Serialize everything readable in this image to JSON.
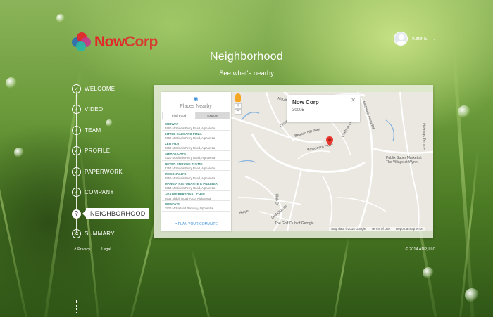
{
  "brand": {
    "name_a": "Now",
    "name_b": "Corp",
    "colors": {
      "red": "#e4262b",
      "blue": "#2e6db4",
      "teal": "#2bb6a3",
      "magenta": "#c4388c"
    }
  },
  "user": {
    "name": "Kate S.",
    "menu_icon": "chevron-down-icon"
  },
  "header": {
    "title": "Neighborhood",
    "subtitle": "See what's nearby"
  },
  "steps": [
    {
      "label": "WELCOME",
      "state": "done"
    },
    {
      "label": "VIDEO",
      "state": "done"
    },
    {
      "label": "TEAM",
      "state": "done"
    },
    {
      "label": "PROFILE",
      "state": "done"
    },
    {
      "label": "PAPERWORK",
      "state": "done"
    },
    {
      "label": "COMPANY",
      "state": "done"
    },
    {
      "label": "NEIGHBORHOOD",
      "state": "current"
    },
    {
      "label": "SUMMARY",
      "state": "upcoming"
    }
  ],
  "footer": {
    "privacy": "Privacy",
    "legal": "Legal",
    "copyright": "© 2014 ADP, LLC."
  },
  "places": {
    "title": "Places Nearby",
    "tabs": [
      "Find Food",
      "Explore"
    ],
    "items": [
      {
        "name": "SUBWAY",
        "address": "5960 McGinnis Ferry Road, Alpharetta"
      },
      {
        "name": "LITTLE CAESARS PIZZA",
        "address": "5960 McGinnis Ferry Road, Alpharetta"
      },
      {
        "name": "ZEN FUJI",
        "address": "5960 McGinnis Ferry Road, Alpharetta"
      },
      {
        "name": "SHIRAZ CAFE",
        "address": "5220 McGinnis Ferry Road, Alpharetta"
      },
      {
        "name": "NEVER ENOUGH THYME",
        "address": "5354 McGinnis Ferry Road, Alpharetta"
      },
      {
        "name": "MCDONALD'S",
        "address": "5950 McGinnis Ferry Road, Alpharetta"
      },
      {
        "name": "MANGIA RISTORANTE & PIZZERIA",
        "address": "5354 McGinnis Ferry Road, Alpharetta"
      },
      {
        "name": "ADAIRE PERSONAL CHEF",
        "address": "6535 Shiloh Road #700, Alpharetta"
      },
      {
        "name": "WENDY'S",
        "address": "3520 McFarland Parkway, Alpharetta"
      }
    ],
    "commute_link": "PLAN YOUR COMMUTE"
  },
  "map": {
    "info_title": "Now Corp",
    "info_zip": "30005",
    "attribution": "Map data ©2015 Google",
    "terms": "Terms of Use",
    "report": "Report a map error",
    "labels": {
      "mcginnis": "McGinnis Ferry Rd",
      "beacon": "Beacon Hill Way",
      "woodward": "Woodward Pkwy",
      "kimball": "Kimball Bridge Rd",
      "golf": "The Golf Club of Georgia",
      "publix": "Publix Super Market at The Village at Wynn",
      "crossing": "Crossing",
      "chelsea": "Chelsea Ln",
      "club": "Club Dr",
      "golfdr": "Golf Club Dr",
      "ridge": "Ridge",
      "hastings": "Hastings Terrace"
    }
  }
}
